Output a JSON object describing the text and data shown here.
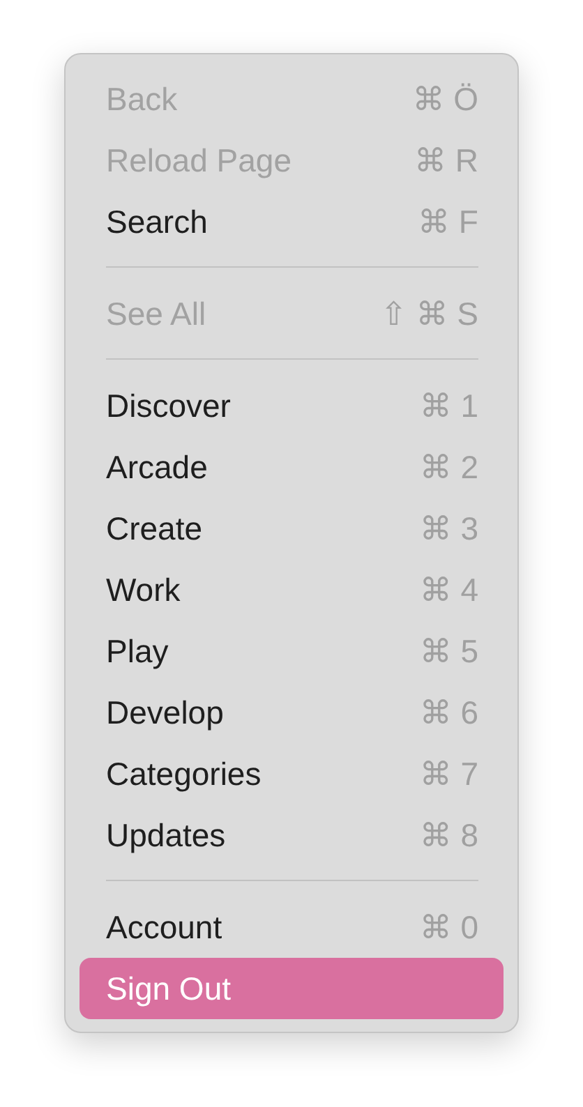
{
  "menu": {
    "items": [
      {
        "kind": "item",
        "label": "Back",
        "shortcut": "⌘ Ö",
        "disabled": true,
        "selected": false
      },
      {
        "kind": "item",
        "label": "Reload Page",
        "shortcut": "⌘ R",
        "disabled": true,
        "selected": false
      },
      {
        "kind": "item",
        "label": "Search",
        "shortcut": "⌘ F",
        "disabled": false,
        "selected": false
      },
      {
        "kind": "separator"
      },
      {
        "kind": "item",
        "label": "See All",
        "shortcut": "⇧ ⌘ S",
        "disabled": true,
        "selected": false
      },
      {
        "kind": "separator"
      },
      {
        "kind": "item",
        "label": "Discover",
        "shortcut": "⌘ 1",
        "disabled": false,
        "selected": false
      },
      {
        "kind": "item",
        "label": "Arcade",
        "shortcut": "⌘ 2",
        "disabled": false,
        "selected": false
      },
      {
        "kind": "item",
        "label": "Create",
        "shortcut": "⌘ 3",
        "disabled": false,
        "selected": false
      },
      {
        "kind": "item",
        "label": "Work",
        "shortcut": "⌘ 4",
        "disabled": false,
        "selected": false
      },
      {
        "kind": "item",
        "label": "Play",
        "shortcut": "⌘ 5",
        "disabled": false,
        "selected": false
      },
      {
        "kind": "item",
        "label": "Develop",
        "shortcut": "⌘ 6",
        "disabled": false,
        "selected": false
      },
      {
        "kind": "item",
        "label": "Categories",
        "shortcut": "⌘ 7",
        "disabled": false,
        "selected": false
      },
      {
        "kind": "item",
        "label": "Updates",
        "shortcut": "⌘ 8",
        "disabled": false,
        "selected": false
      },
      {
        "kind": "separator"
      },
      {
        "kind": "item",
        "label": "Account",
        "shortcut": "⌘ 0",
        "disabled": false,
        "selected": false
      },
      {
        "kind": "item",
        "label": "Sign Out",
        "disabled": false,
        "selected": true
      }
    ]
  }
}
